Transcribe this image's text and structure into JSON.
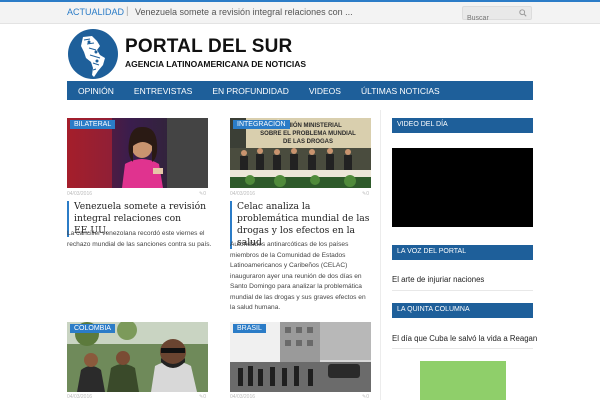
{
  "topbar": {
    "ticker_label": "ACTUALIDAD",
    "ticker_sep": "|",
    "ticker_text": "Venezuela somete a revisión integral relaciones con ...",
    "search_placeholder": "Buscar"
  },
  "logo": {
    "title": "PORTAL DEL SUR",
    "subtitle": "AGENCIA LATINOAMERICANA DE NOTICIAS"
  },
  "nav": {
    "items": [
      {
        "label": "OPINIÓN"
      },
      {
        "label": "ENTREVISTAS"
      },
      {
        "label": "EN PROFUNDIDAD"
      },
      {
        "label": "VIDEOS"
      },
      {
        "label": "ÚLTIMAS NOTICIAS"
      }
    ]
  },
  "articles": [
    {
      "category": "BILATERAL",
      "date": "04/03/2016",
      "comments": "0",
      "title": "Venezuela somete a revisión integral relaciones con EE.UU.",
      "excerpt": "La canciller venezolana recordó este viernes el rechazo mundial de las sanciones contra su país."
    },
    {
      "category": "INTEGRACIÓN",
      "date": "04/03/2016",
      "comments": "0",
      "image_text": "REUNIÓN MINISTERIAL SOBRE EL PROBLEMA MUNDIAL DE LAS DROGAS",
      "title": "Celac analiza la problemática mundial de las drogas y los efectos en la salud",
      "excerpt": "Autoridades antinarcóticas de los países miembros de la Comunidad de Estados Latinoamericanos y Caribeños (CELAC) inauguraron ayer una reunión de dos días en Santo Domingo para analizar la problemática mundial de las drogas y sus graves efectos en la salud humana."
    },
    {
      "category": "COLOMBIA",
      "date": "04/03/2016",
      "comments": "0"
    },
    {
      "category": "BRASIL",
      "date": "04/03/2016",
      "comments": "0"
    }
  ],
  "sidebar": {
    "video_heading": "VIDEO DEL DÍA",
    "voz_heading": "LA VOZ DEL PORTAL",
    "voz_link": "El arte de injuriar naciones",
    "quinta_heading": "LA QUINTA COLUMNA",
    "quinta_link": "El día que Cuba le salvó la vida a Reagan"
  },
  "colors": {
    "accent": "#2b7cc7",
    "nav": "#1e5f9a"
  }
}
